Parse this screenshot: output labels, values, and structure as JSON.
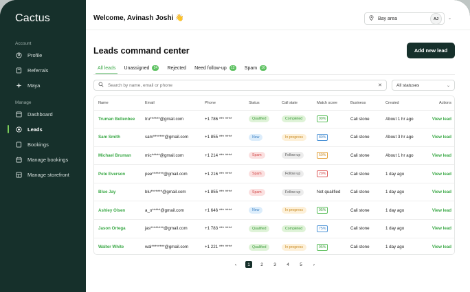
{
  "brand": "Cactus",
  "sidebar": {
    "sections": [
      {
        "title": "Account",
        "items": [
          {
            "label": "Profile",
            "icon": "profile-icon"
          },
          {
            "label": "Referrals",
            "icon": "referrals-icon"
          },
          {
            "label": "Maya",
            "icon": "sparkle-icon"
          }
        ]
      },
      {
        "title": "Manage",
        "items": [
          {
            "label": "Dashboard",
            "icon": "dashboard-icon"
          },
          {
            "label": "Leads",
            "icon": "leads-icon",
            "active": true
          },
          {
            "label": "Bookings",
            "icon": "bookings-icon"
          },
          {
            "label": "Manage bookings",
            "icon": "calendar-icon"
          },
          {
            "label": "Manage storefront",
            "icon": "storefront-icon"
          }
        ]
      }
    ]
  },
  "header": {
    "welcome": "Welcome, Avinash Joshi 👋",
    "location": "Bay area",
    "avatar_initials": "AJ"
  },
  "main": {
    "title": "Leads command center",
    "add_button": "Add new lead",
    "tabs": [
      {
        "label": "All leads",
        "active": true
      },
      {
        "label": "Unassigned",
        "badge": "24"
      },
      {
        "label": "Rejected"
      },
      {
        "label": "Need follow-up",
        "badge": "12"
      },
      {
        "label": "Spam",
        "badge": "10"
      }
    ],
    "search_placeholder": "Search by name, email or phone",
    "status_filter": "All statuses",
    "columns": [
      "Name",
      "Email",
      "Phone",
      "Status",
      "Call state",
      "Match score",
      "Business",
      "Created",
      "Actions"
    ],
    "rows": [
      {
        "name": "Truman Bellenbee",
        "email": "tru******@gmail.com",
        "phone": "+1 786 *** ****",
        "status": "Qualified",
        "status_kind": "qualified",
        "call": "Completed",
        "call_kind": "completed",
        "score": "90%",
        "score_kind": "green",
        "business": "Cali stone",
        "created": "About 1 hr ago",
        "action": "View lead"
      },
      {
        "name": "Sam Smith",
        "email": "sam*******@gmail.com",
        "phone": "+1 855 *** ****",
        "status": "New",
        "status_kind": "new",
        "call": "In progress",
        "call_kind": "inprogress",
        "score": "80%",
        "score_kind": "blue",
        "business": "Cali stone",
        "created": "About 3 hr ago",
        "action": "View lead"
      },
      {
        "name": "Michael Bruman",
        "email": "mic*****@gmail.com",
        "phone": "+1 214 *** ****",
        "status": "Spam",
        "status_kind": "spam",
        "call": "Follow up",
        "call_kind": "followup",
        "score": "50%",
        "score_kind": "orange",
        "business": "Cali stone",
        "created": "About 1 hr ago",
        "action": "View lead"
      },
      {
        "name": "Pete Everson",
        "email": "pee*******@gmail.com",
        "phone": "+1 216 *** ****",
        "status": "Spam",
        "status_kind": "spam",
        "call": "Follow up",
        "call_kind": "followup",
        "score": "20%",
        "score_kind": "red",
        "business": "Cali stone",
        "created": "1 day ago",
        "action": "View lead"
      },
      {
        "name": "Blue Jay",
        "email": "blu*******@gmail.com",
        "phone": "+1 855 *** ****",
        "status": "Spam",
        "status_kind": "spam",
        "call": "Follow up",
        "call_kind": "followup",
        "score": "Not qualified",
        "score_kind": "text",
        "business": "Cali stone",
        "created": "1 day ago",
        "action": "View lead"
      },
      {
        "name": "Ashley Olsen",
        "email": "a_o*****@gmail.com",
        "phone": "+1 646 *** ****",
        "status": "New",
        "status_kind": "new",
        "call": "In progress",
        "call_kind": "inprogress",
        "score": "95%",
        "score_kind": "green",
        "business": "Cali stone",
        "created": "1 day ago",
        "action": "View lead"
      },
      {
        "name": "Jason Ortega",
        "email": "jas********@gmail.com",
        "phone": "+1 783 *** ****",
        "status": "Qualified",
        "status_kind": "qualified",
        "call": "Completed",
        "call_kind": "completed",
        "score": "75%",
        "score_kind": "blue",
        "business": "Cali stone",
        "created": "1 day ago",
        "action": "View lead"
      },
      {
        "name": "Walter White",
        "email": "wal********@gmail.com",
        "phone": "+1 221 *** ****",
        "status": "Qualified",
        "status_kind": "qualified",
        "call": "In progress",
        "call_kind": "inprogress",
        "score": "95%",
        "score_kind": "green",
        "business": "Cali stone",
        "created": "1 day ago",
        "action": "View lead"
      }
    ],
    "pagination": {
      "prev": "‹",
      "pages": [
        "1",
        "2",
        "3",
        "4",
        "5"
      ],
      "current": "1",
      "next": "›"
    }
  },
  "colors": {
    "sidebar_bg": "#16302b",
    "accent": "#3aa846",
    "button_bg": "#16302b"
  }
}
